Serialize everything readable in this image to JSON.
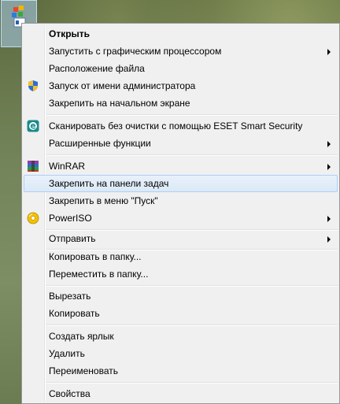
{
  "colors": {
    "menu_bg": "#f0f0f0",
    "hover_bg": "#dbe9f7",
    "hover_border": "#aecff7",
    "text": "#000000"
  },
  "desktop": {
    "selected_icon": "application-icon"
  },
  "menu": {
    "items": {
      "open": "Открыть",
      "run_gpu": "Запустить с графическим процессором",
      "file_location": "Расположение файла",
      "run_as_admin": "Запуск от имени администратора",
      "pin_start": "Закрепить на начальном экране",
      "eset_scan": "Сканировать без очистки с помощью ESET Smart Security",
      "advanced": "Расширенные функции",
      "winrar": "WinRAR",
      "pin_taskbar": "Закрепить на панели задач",
      "pin_start_menu": "Закрепить в меню \"Пуск\"",
      "poweriso": "PowerISO",
      "send_to": "Отправить",
      "copy_to_folder": "Копировать в папку...",
      "move_to_folder": "Переместить в папку...",
      "cut": "Вырезать",
      "copy": "Копировать",
      "create_shortcut": "Создать ярлык",
      "delete": "Удалить",
      "rename": "Переименовать",
      "properties": "Свойства"
    },
    "icons": {
      "run_as_admin": "uac-shield-icon",
      "eset_scan": "eset-icon",
      "winrar": "winrar-icon",
      "poweriso": "poweriso-icon"
    },
    "hovered_item": "pin_taskbar"
  }
}
